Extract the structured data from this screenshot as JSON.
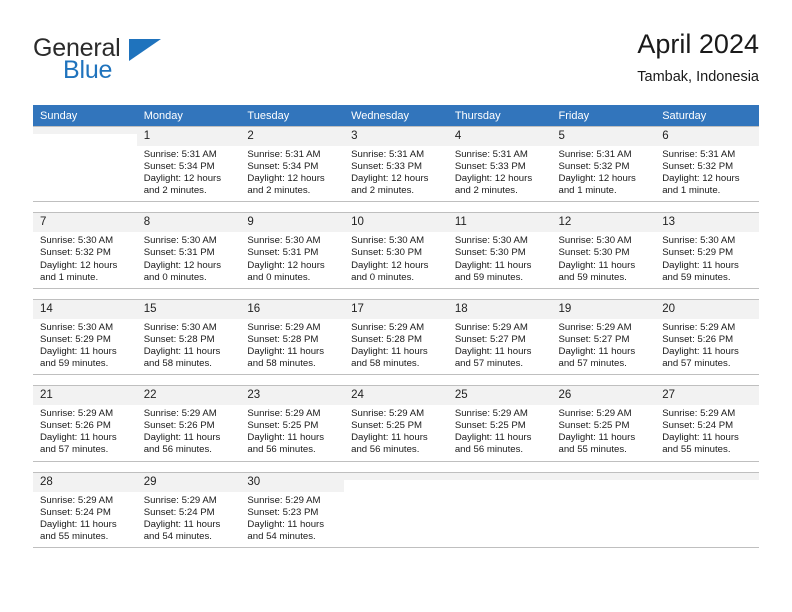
{
  "brand": {
    "name_part1": "General",
    "name_part2": "Blue",
    "triangle_color": "#1f73bd"
  },
  "header": {
    "title": "April 2024",
    "location": "Tambak, Indonesia"
  },
  "theme": {
    "header_row_bg": "#3275bc",
    "header_row_text": "#ffffff",
    "daynum_bg": "#f2f2f2",
    "grid_line": "#bfbfbf"
  },
  "weekdays": [
    "Sunday",
    "Monday",
    "Tuesday",
    "Wednesday",
    "Thursday",
    "Friday",
    "Saturday"
  ],
  "weeks": [
    [
      {
        "day": "",
        "sunrise": "",
        "sunset": "",
        "daylight": "",
        "blank": true
      },
      {
        "day": "1",
        "sunrise": "Sunrise: 5:31 AM",
        "sunset": "Sunset: 5:34 PM",
        "daylight": "Daylight: 12 hours and 2 minutes."
      },
      {
        "day": "2",
        "sunrise": "Sunrise: 5:31 AM",
        "sunset": "Sunset: 5:34 PM",
        "daylight": "Daylight: 12 hours and 2 minutes."
      },
      {
        "day": "3",
        "sunrise": "Sunrise: 5:31 AM",
        "sunset": "Sunset: 5:33 PM",
        "daylight": "Daylight: 12 hours and 2 minutes."
      },
      {
        "day": "4",
        "sunrise": "Sunrise: 5:31 AM",
        "sunset": "Sunset: 5:33 PM",
        "daylight": "Daylight: 12 hours and 2 minutes."
      },
      {
        "day": "5",
        "sunrise": "Sunrise: 5:31 AM",
        "sunset": "Sunset: 5:32 PM",
        "daylight": "Daylight: 12 hours and 1 minute."
      },
      {
        "day": "6",
        "sunrise": "Sunrise: 5:31 AM",
        "sunset": "Sunset: 5:32 PM",
        "daylight": "Daylight: 12 hours and 1 minute."
      }
    ],
    [
      {
        "day": "7",
        "sunrise": "Sunrise: 5:30 AM",
        "sunset": "Sunset: 5:32 PM",
        "daylight": "Daylight: 12 hours and 1 minute."
      },
      {
        "day": "8",
        "sunrise": "Sunrise: 5:30 AM",
        "sunset": "Sunset: 5:31 PM",
        "daylight": "Daylight: 12 hours and 0 minutes."
      },
      {
        "day": "9",
        "sunrise": "Sunrise: 5:30 AM",
        "sunset": "Sunset: 5:31 PM",
        "daylight": "Daylight: 12 hours and 0 minutes."
      },
      {
        "day": "10",
        "sunrise": "Sunrise: 5:30 AM",
        "sunset": "Sunset: 5:30 PM",
        "daylight": "Daylight: 12 hours and 0 minutes."
      },
      {
        "day": "11",
        "sunrise": "Sunrise: 5:30 AM",
        "sunset": "Sunset: 5:30 PM",
        "daylight": "Daylight: 11 hours and 59 minutes."
      },
      {
        "day": "12",
        "sunrise": "Sunrise: 5:30 AM",
        "sunset": "Sunset: 5:30 PM",
        "daylight": "Daylight: 11 hours and 59 minutes."
      },
      {
        "day": "13",
        "sunrise": "Sunrise: 5:30 AM",
        "sunset": "Sunset: 5:29 PM",
        "daylight": "Daylight: 11 hours and 59 minutes."
      }
    ],
    [
      {
        "day": "14",
        "sunrise": "Sunrise: 5:30 AM",
        "sunset": "Sunset: 5:29 PM",
        "daylight": "Daylight: 11 hours and 59 minutes."
      },
      {
        "day": "15",
        "sunrise": "Sunrise: 5:30 AM",
        "sunset": "Sunset: 5:28 PM",
        "daylight": "Daylight: 11 hours and 58 minutes."
      },
      {
        "day": "16",
        "sunrise": "Sunrise: 5:29 AM",
        "sunset": "Sunset: 5:28 PM",
        "daylight": "Daylight: 11 hours and 58 minutes."
      },
      {
        "day": "17",
        "sunrise": "Sunrise: 5:29 AM",
        "sunset": "Sunset: 5:28 PM",
        "daylight": "Daylight: 11 hours and 58 minutes."
      },
      {
        "day": "18",
        "sunrise": "Sunrise: 5:29 AM",
        "sunset": "Sunset: 5:27 PM",
        "daylight": "Daylight: 11 hours and 57 minutes."
      },
      {
        "day": "19",
        "sunrise": "Sunrise: 5:29 AM",
        "sunset": "Sunset: 5:27 PM",
        "daylight": "Daylight: 11 hours and 57 minutes."
      },
      {
        "day": "20",
        "sunrise": "Sunrise: 5:29 AM",
        "sunset": "Sunset: 5:26 PM",
        "daylight": "Daylight: 11 hours and 57 minutes."
      }
    ],
    [
      {
        "day": "21",
        "sunrise": "Sunrise: 5:29 AM",
        "sunset": "Sunset: 5:26 PM",
        "daylight": "Daylight: 11 hours and 57 minutes."
      },
      {
        "day": "22",
        "sunrise": "Sunrise: 5:29 AM",
        "sunset": "Sunset: 5:26 PM",
        "daylight": "Daylight: 11 hours and 56 minutes."
      },
      {
        "day": "23",
        "sunrise": "Sunrise: 5:29 AM",
        "sunset": "Sunset: 5:25 PM",
        "daylight": "Daylight: 11 hours and 56 minutes."
      },
      {
        "day": "24",
        "sunrise": "Sunrise: 5:29 AM",
        "sunset": "Sunset: 5:25 PM",
        "daylight": "Daylight: 11 hours and 56 minutes."
      },
      {
        "day": "25",
        "sunrise": "Sunrise: 5:29 AM",
        "sunset": "Sunset: 5:25 PM",
        "daylight": "Daylight: 11 hours and 56 minutes."
      },
      {
        "day": "26",
        "sunrise": "Sunrise: 5:29 AM",
        "sunset": "Sunset: 5:25 PM",
        "daylight": "Daylight: 11 hours and 55 minutes."
      },
      {
        "day": "27",
        "sunrise": "Sunrise: 5:29 AM",
        "sunset": "Sunset: 5:24 PM",
        "daylight": "Daylight: 11 hours and 55 minutes."
      }
    ],
    [
      {
        "day": "28",
        "sunrise": "Sunrise: 5:29 AM",
        "sunset": "Sunset: 5:24 PM",
        "daylight": "Daylight: 11 hours and 55 minutes."
      },
      {
        "day": "29",
        "sunrise": "Sunrise: 5:29 AM",
        "sunset": "Sunset: 5:24 PM",
        "daylight": "Daylight: 11 hours and 54 minutes."
      },
      {
        "day": "30",
        "sunrise": "Sunrise: 5:29 AM",
        "sunset": "Sunset: 5:23 PM",
        "daylight": "Daylight: 11 hours and 54 minutes."
      },
      {
        "day": "",
        "sunrise": "",
        "sunset": "",
        "daylight": "",
        "blank": true
      },
      {
        "day": "",
        "sunrise": "",
        "sunset": "",
        "daylight": "",
        "blank": true
      },
      {
        "day": "",
        "sunrise": "",
        "sunset": "",
        "daylight": "",
        "blank": true
      },
      {
        "day": "",
        "sunrise": "",
        "sunset": "",
        "daylight": "",
        "blank": true
      }
    ]
  ]
}
